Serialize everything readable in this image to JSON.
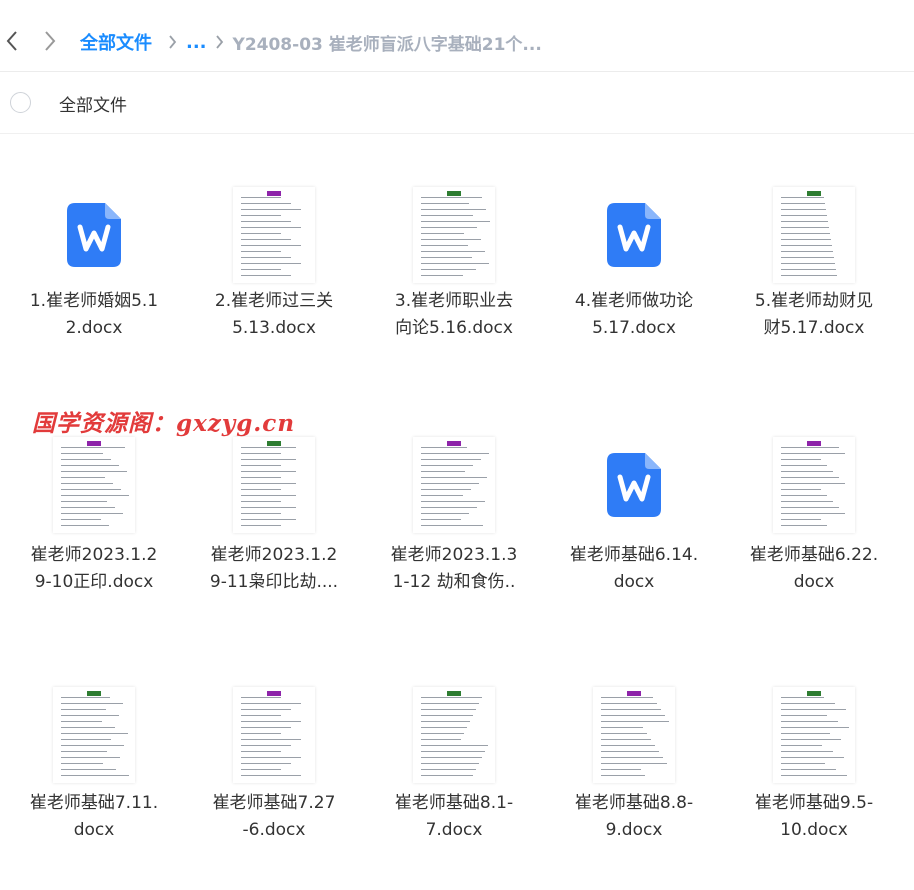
{
  "header": {
    "crumb_root": "全部文件",
    "crumb_more": "...",
    "crumb_current": "Y2408-03 崔老师盲派八字基础21个..."
  },
  "select_row": {
    "label": "全部文件"
  },
  "watermark": "国学资源阁：gxzyg.cn",
  "colors": {
    "accent": "#1a8cff",
    "word_icon": "#2f7cf6",
    "watermark": "#e23b3b"
  },
  "files": [
    {
      "line1": "1.崔老师婚姻5.1",
      "line2": "2.docx",
      "thumb": "word-icon"
    },
    {
      "line1": "2.崔老师过三关",
      "line2": "5.13.docx",
      "thumb": "doc-preview"
    },
    {
      "line1": "3.崔老师职业去",
      "line2": "向论5.16.docx",
      "thumb": "doc-preview"
    },
    {
      "line1": "4.崔老师做功论",
      "line2": "5.17.docx",
      "thumb": "word-icon"
    },
    {
      "line1": "5.崔老师劫财见",
      "line2": "财5.17.docx",
      "thumb": "doc-preview"
    },
    {
      "line1": "崔老师2023.1.2",
      "line2": "9-10正印.docx",
      "thumb": "doc-preview"
    },
    {
      "line1": "崔老师2023.1.2",
      "line2": "9-11枭印比劫....",
      "thumb": "doc-preview"
    },
    {
      "line1": "崔老师2023.1.3",
      "line2": "1-12 劫和食伤..",
      "thumb": "doc-preview"
    },
    {
      "line1": "崔老师基础6.14.",
      "line2": "docx",
      "thumb": "word-icon"
    },
    {
      "line1": "崔老师基础6.22.",
      "line2": "docx",
      "thumb": "doc-preview"
    },
    {
      "line1": "崔老师基础7.11.",
      "line2": "docx",
      "thumb": "doc-preview"
    },
    {
      "line1": "崔老师基础7.27",
      "line2": "-6.docx",
      "thumb": "doc-preview"
    },
    {
      "line1": "崔老师基础8.1-",
      "line2": "7.docx",
      "thumb": "doc-preview"
    },
    {
      "line1": "崔老师基础8.8-",
      "line2": "9.docx",
      "thumb": "doc-preview"
    },
    {
      "line1": "崔老师基础9.5-",
      "line2": "10.docx",
      "thumb": "doc-preview"
    }
  ]
}
